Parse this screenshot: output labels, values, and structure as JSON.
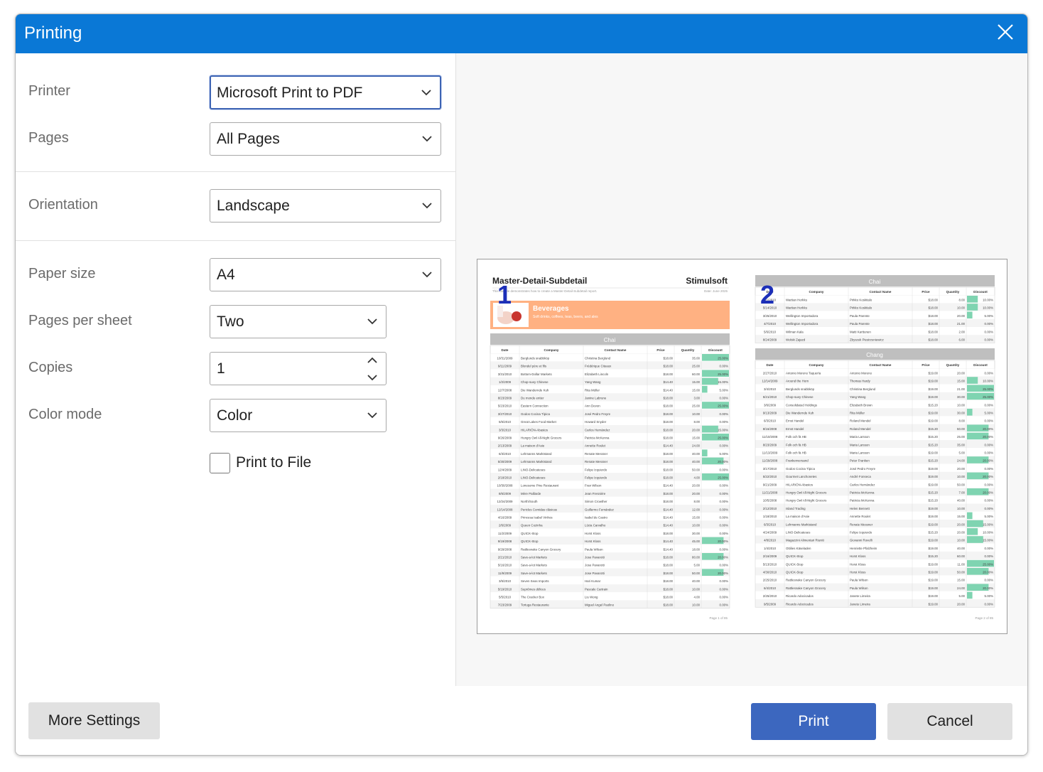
{
  "dialog": {
    "title": "Printing",
    "close_icon": "close-icon",
    "accent": "#0a78d6"
  },
  "settings": {
    "printer": {
      "label": "Printer",
      "value": "Microsoft Print to PDF"
    },
    "pages": {
      "label": "Pages",
      "value": "All Pages"
    },
    "orientation": {
      "label": "Orientation",
      "value": "Landscape"
    },
    "paper_size": {
      "label": "Paper size",
      "value": "A4"
    },
    "pages_per_sheet": {
      "label": "Pages per sheet",
      "value": "Two"
    },
    "copies": {
      "label": "Copies",
      "value": "1"
    },
    "color_mode": {
      "label": "Color mode",
      "value": "Color"
    },
    "print_to_file": {
      "label": "Print to File",
      "checked": false
    }
  },
  "preview": {
    "page1": {
      "number": "1",
      "report_title": "Master-Detail-Subdetail",
      "brand": "Stimulsoft",
      "subtitle": "This sample demonstrates how to create a Master-Detail-Subdetail report.",
      "date": "Date: June 2025",
      "category": "Beverages",
      "category_desc": "Soft drinks, coffees, teas, beers, and ales",
      "product": "Chai",
      "footer": "Page 1 of 85",
      "rows": [
        [
          "10/31/2009",
          "Berglunds snabbköp",
          "Christina Berglund",
          "$18.00",
          "35.00",
          25
        ],
        [
          "9/11/2009",
          "Blondel père et fils",
          "Frédérique Citeaux",
          "$18.00",
          "25.00",
          0
        ],
        [
          "3/31/2010",
          "Bottom-Dollar Markets",
          "Elizabeth Lincoln",
          "$18.00",
          "60.00",
          25
        ],
        [
          "1/2/2009",
          "Chop-suey Chinese",
          "Yang Wang",
          "$14.40",
          "15.00",
          15
        ],
        [
          "12/7/2008",
          "Die Wandernde Kuh",
          "Rita Müller",
          "$14.40",
          "15.00",
          5
        ],
        [
          "8/23/2009",
          "Du monde entier",
          "Janine Labrune",
          "$18.00",
          "3.00",
          0
        ],
        [
          "5/23/2010",
          "Eastern Connection",
          "Ann Devon",
          "$18.00",
          "25.00",
          25
        ],
        [
          "3/27/2010",
          "Godos Cocina Típica",
          "José Pedro Freyre",
          "$18.00",
          "10.00",
          0
        ],
        [
          "5/6/2010",
          "Great Lakes Food Market",
          "Howard Snyder",
          "$18.00",
          "8.00",
          0
        ],
        [
          "3/3/2010",
          "HILARIÓN-Abastos",
          "Carlos Hernández",
          "$18.00",
          "20.00",
          15
        ],
        [
          "9/26/2009",
          "Hungry Owl All-Night Grocers",
          "Patricia McKenna",
          "$18.00",
          "15.00",
          25
        ],
        [
          "2/13/2009",
          "La maison d'Asie",
          "Annette Roulet",
          "$14.40",
          "24.00",
          0
        ],
        [
          "6/3/2010",
          "Lehmanns Marktstand",
          "Renate Messner",
          "$18.00",
          "40.00",
          5
        ],
        [
          "5/30/2009",
          "Lehmanns Marktstand",
          "Renate Messner",
          "$18.00",
          "40.00",
          20
        ],
        [
          "12/4/2009",
          "LINO-Delicateses",
          "Felipe Izquierdo",
          "$18.00",
          "50.00",
          0
        ],
        [
          "2/18/2010",
          "LINO-Delicateses",
          "Felipe Izquierdo",
          "$18.00",
          "4.00",
          25
        ],
        [
          "10/30/2008",
          "Lonesome Pine Restaurant",
          "Fran Wilson",
          "$14.40",
          "20.00",
          0
        ],
        [
          "8/6/2009",
          "Mère Paillarde",
          "Jean Fresnière",
          "$18.00",
          "20.00",
          0
        ],
        [
          "12/24/2009",
          "North/South",
          "Simon Crowther",
          "$18.00",
          "8.00",
          0
        ],
        [
          "12/14/2008",
          "Pericles Comidas clásicas",
          "Guillermo Fernández",
          "$14.40",
          "12.00",
          0
        ],
        [
          "4/16/2009",
          "Princesa Isabel Vinhos",
          "Isabel de Castro",
          "$14.40",
          "15.00",
          0
        ],
        [
          "2/6/2009",
          "Queen Cozinha",
          "Lúcia Carvalho",
          "$14.40",
          "10.00",
          0
        ],
        [
          "11/2/2009",
          "QUICK-Stop",
          "Horst Kloss",
          "$18.00",
          "30.00",
          0
        ],
        [
          "9/19/2008",
          "QUICK-Stop",
          "Horst Kloss",
          "$14.40",
          "45.00",
          20
        ],
        [
          "9/29/2008",
          "Rattlesnake Canyon Grocery",
          "Paula Wilson",
          "$14.40",
          "18.00",
          0
        ],
        [
          "2/21/2010",
          "Save-a-lot Markets",
          "Jose Pavarotti",
          "$18.00",
          "80.00",
          20
        ],
        [
          "5/16/2010",
          "Save-a-lot Markets",
          "Jose Pavarotti",
          "$18.00",
          "5.00",
          0
        ],
        [
          "11/9/2009",
          "Save-a-lot Markets",
          "Jose Pavarotti",
          "$18.00",
          "50.00",
          20
        ],
        [
          "3/5/2010",
          "Seven Seas Imports",
          "Hari Kumar",
          "$18.00",
          "40.00",
          0
        ],
        [
          "5/19/2010",
          "Suprêmes délices",
          "Pascale Cartrain",
          "$18.00",
          "10.00",
          0
        ],
        [
          "5/5/2010",
          "The Cracker Box",
          "Liu Wong",
          "$18.00",
          "4.00",
          0
        ],
        [
          "7/23/2009",
          "Tortuga Restaurante",
          "Miguel Angel Paolino",
          "$18.00",
          "10.00",
          0
        ]
      ]
    },
    "page2": {
      "number": "2",
      "product1": "Chai",
      "product2": "Chang",
      "footer": "Page 2 of 85",
      "rows1": [
        [
          "2/1/2010",
          "Wartian Herkku",
          "Pirkko Koskitalo",
          "$18.00",
          "8.00",
          10
        ],
        [
          "5/14/2010",
          "Wartian Herkku",
          "Pirkko Koskitalo",
          "$18.00",
          "10.00",
          10
        ],
        [
          "3/25/2010",
          "Wellington Importadora",
          "Paula Parente",
          "$18.00",
          "20.00",
          5
        ],
        [
          "4/7/2010",
          "Wellington Importadora",
          "Paula Parente",
          "$18.00",
          "21.00",
          0
        ],
        [
          "5/6/2010",
          "Wilman Kala",
          "Matti Karttunen",
          "$18.00",
          "2.00",
          0
        ],
        [
          "8/24/2009",
          "Wolski Zajazd",
          "Zbyszek Piestrzeniewicz",
          "$18.00",
          "6.00",
          0
        ]
      ],
      "rows2": [
        [
          "2/27/2010",
          "Antonio Moreno Taquería",
          "Antonio Moreno",
          "$19.00",
          "20.00",
          0
        ],
        [
          "12/14/2009",
          "Around the Horn",
          "Thomas Hardy",
          "$19.00",
          "15.00",
          10
        ],
        [
          "3/4/2010",
          "Berglunds snabbköp",
          "Christina Berglund",
          "$19.00",
          "21.00",
          25
        ],
        [
          "5/21/2010",
          "Chop-suey Chinese",
          "Yang Wang",
          "$19.00",
          "30.00",
          25
        ],
        [
          "3/6/2009",
          "Consolidated Holdings",
          "Elizabeth Brown",
          "$15.20",
          "10.00",
          0
        ],
        [
          "9/13/2009",
          "Die Wandernde Kuh",
          "Rita Müller",
          "$19.00",
          "30.00",
          5
        ],
        [
          "6/3/2010",
          "Ernst Handel",
          "Roland Mendel",
          "$19.00",
          "8.00",
          0
        ],
        [
          "8/16/2008",
          "Ernst Handel",
          "Roland Mendel",
          "$15.20",
          "50.00",
          20
        ],
        [
          "11/10/2008",
          "Folk och fä HB",
          "Maria Larsson",
          "$15.20",
          "25.00",
          20
        ],
        [
          "8/23/2009",
          "Folk och fä HB",
          "Maria Larsson",
          "$15.20",
          "35.00",
          0
        ],
        [
          "11/13/2009",
          "Folk och fä HB",
          "Maria Larsson",
          "$19.00",
          "5.00",
          0
        ],
        [
          "11/29/2008",
          "Frankenversand",
          "Peter Franken",
          "$15.20",
          "24.00",
          20
        ],
        [
          "3/17/2010",
          "Godos Cocina Típica",
          "José Pedro Freyre",
          "$19.00",
          "20.00",
          0
        ],
        [
          "5/22/2010",
          "Gourmet Lanchonetes",
          "André Fonseca",
          "$19.00",
          "10.00",
          20
        ],
        [
          "9/21/2009",
          "HILARIÓN-Abastos",
          "Carlos Hernández",
          "$19.00",
          "50.00",
          0
        ],
        [
          "11/21/2008",
          "Hungry Owl All-Night Grocers",
          "Patricia McKenna",
          "$15.20",
          "7.00",
          20
        ],
        [
          "10/5/2008",
          "Hungry Owl All-Night Grocers",
          "Patricia McKenna",
          "$15.20",
          "40.00",
          0
        ],
        [
          "2/12/2010",
          "Island Trading",
          "Helen Bennett",
          "$19.00",
          "10.00",
          0
        ],
        [
          "1/18/2010",
          "La maison d'Asie",
          "Annette Roulet",
          "$19.00",
          "15.00",
          5
        ],
        [
          "6/3/2010",
          "Lehmanns Marktstand",
          "Renate Messner",
          "$19.00",
          "20.00",
          15
        ],
        [
          "4/24/2009",
          "LINO-Delicateses",
          "Felipe Izquierdo",
          "$15.20",
          "20.00",
          10
        ],
        [
          "4/8/2010",
          "Magazzini Alimentari Riuniti",
          "Giovanni Rovelli",
          "$19.00",
          "10.00",
          15
        ],
        [
          "1/4/2010",
          "Ottilies Käseladen",
          "Henriette Pfalzheim",
          "$19.00",
          "40.00",
          0
        ],
        [
          "2/16/2009",
          "QUICK-Stop",
          "Horst Kloss",
          "$15.20",
          "60.00",
          0
        ],
        [
          "5/13/2010",
          "QUICK-Stop",
          "Horst Kloss",
          "$19.00",
          "11.00",
          25
        ],
        [
          "4/30/2010",
          "QUICK-Stop",
          "Horst Kloss",
          "$19.00",
          "50.00",
          20
        ],
        [
          "2/25/2010",
          "Rattlesnake Canyon Grocery",
          "Paula Wilson",
          "$19.00",
          "15.00",
          0
        ],
        [
          "6/4/2010",
          "Rattlesnake Canyon Grocery",
          "Paula Wilson",
          "$19.00",
          "24.00",
          20
        ],
        [
          "2/25/2010",
          "Ricardo Adocicados",
          "Janete Limeira",
          "$19.00",
          "5.00",
          5
        ],
        [
          "9/5/2009",
          "Ricardo Adocicados",
          "Janete Limeira",
          "$19.00",
          "20.00",
          0
        ]
      ]
    },
    "columns": [
      "Date",
      "Company",
      "Contact Name",
      "Price",
      "Quantity",
      "Discount"
    ],
    "bar_color": "#7fd4b1",
    "band_color": "#ffb182"
  },
  "footer": {
    "more_settings": "More Settings",
    "print": "Print",
    "cancel": "Cancel"
  }
}
